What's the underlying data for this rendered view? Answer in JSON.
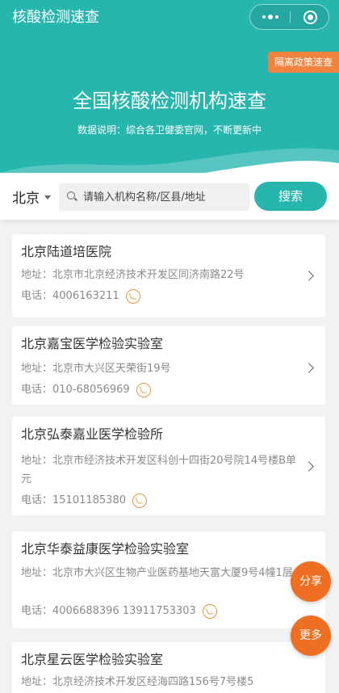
{
  "app": {
    "title": "核酸检测速查"
  },
  "hero": {
    "policy_button": "隔离政策速查",
    "title": "全国核酸检测机构速查",
    "subtitle": "数据说明：综合各卫健委官网，不断更新中"
  },
  "search": {
    "city": "北京",
    "placeholder": "请输入机构名称/区县/地址",
    "button": "搜索"
  },
  "institutions": [
    {
      "name": "北京陆道培医院",
      "address": "地址：北京市北京经济技术开发区同济南路22号",
      "phone": "电话：4006163211"
    },
    {
      "name": "北京嘉宝医学检验实验室",
      "address": "地址：北京市大兴区天荣街19号",
      "phone": "电话：010-68056969"
    },
    {
      "name": "北京弘泰嘉业医学检验所",
      "address": "地址：北京市经济技术开发区科创十四街20号院14号楼B单元",
      "phone": "电话：15101185380"
    },
    {
      "name": "北京华泰益康医学检验实验室",
      "address": "地址：北京市大兴区生物产业医药基地天富大厦9号4幢1层",
      "phone": "电话：4006688396 13911753303"
    },
    {
      "name": "北京星云医学检验实验室",
      "address": "地址：北京经济技术开发区经海四路156号7号楼5",
      "phone": ""
    }
  ],
  "fab": {
    "share": "分享",
    "more": "更多"
  },
  "colors": {
    "brand_teal": "#27b6ae",
    "orange": "#f0843f",
    "fab_orange": "#ee6f22"
  }
}
